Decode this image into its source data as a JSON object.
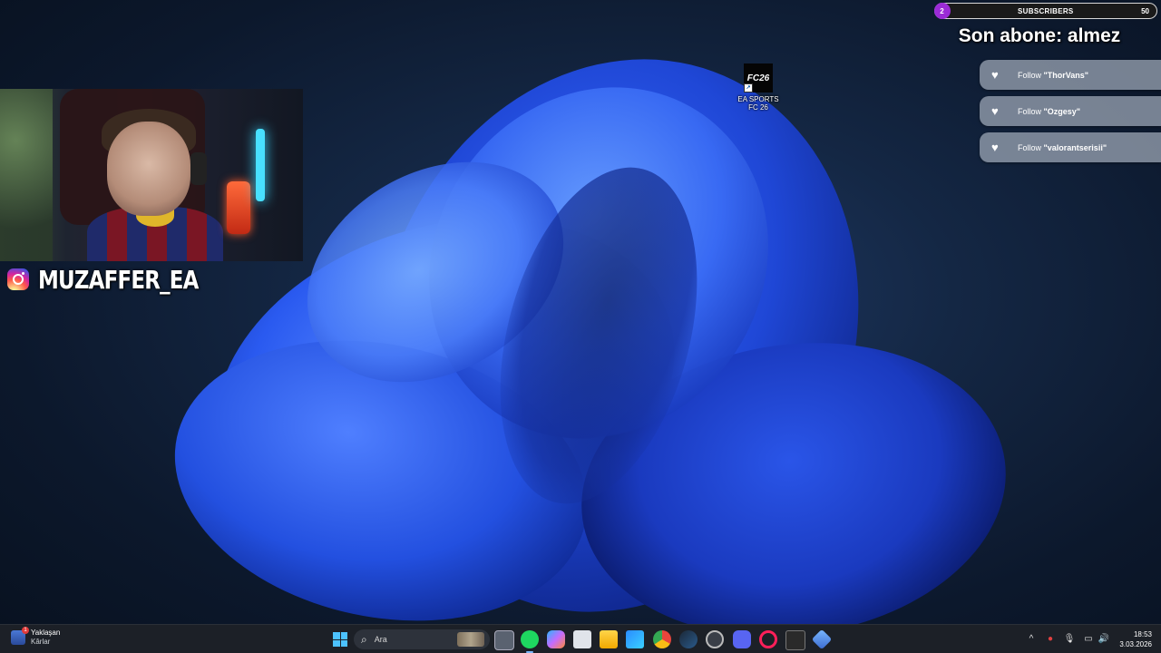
{
  "stream_overlay": {
    "subscribers": {
      "current": "2",
      "title": "SUBSCRIBERS",
      "goal": "50",
      "progress_fraction": 0.04
    },
    "last_subscriber": "Son abone: almez",
    "follow_alerts": [
      {
        "prefix": "Follow ",
        "name": "\"ThorVans\""
      },
      {
        "prefix": "Follow ",
        "name": "\"Ozgesy\""
      },
      {
        "prefix": "Follow ",
        "name": "\"valorantserisii\""
      }
    ],
    "instagram_handle": "MUZAFFER_EA"
  },
  "desktop": {
    "icons": [
      {
        "label_line1": "EA SPORTS",
        "label_line2": "FC 26",
        "icon_text": "FC26"
      }
    ]
  },
  "taskbar": {
    "weather": {
      "title": "Yaklaşan",
      "subtitle": "Kârlar",
      "badge": "1"
    },
    "search_placeholder": "Ara",
    "apps": [
      "task-view",
      "spotify",
      "copilot",
      "snipping-tool",
      "file-explorer",
      "microsoft-store",
      "chrome",
      "steam",
      "origin",
      "discord",
      "opera-gx",
      "epic-games",
      "app-cube"
    ],
    "clock": {
      "time": "18:53",
      "date": "3.03.2026"
    }
  },
  "colors": {
    "accent_purple": "#9b2bd6",
    "taskbar_bg": "#1c2027",
    "windows_blue": "#4cc2ff"
  }
}
